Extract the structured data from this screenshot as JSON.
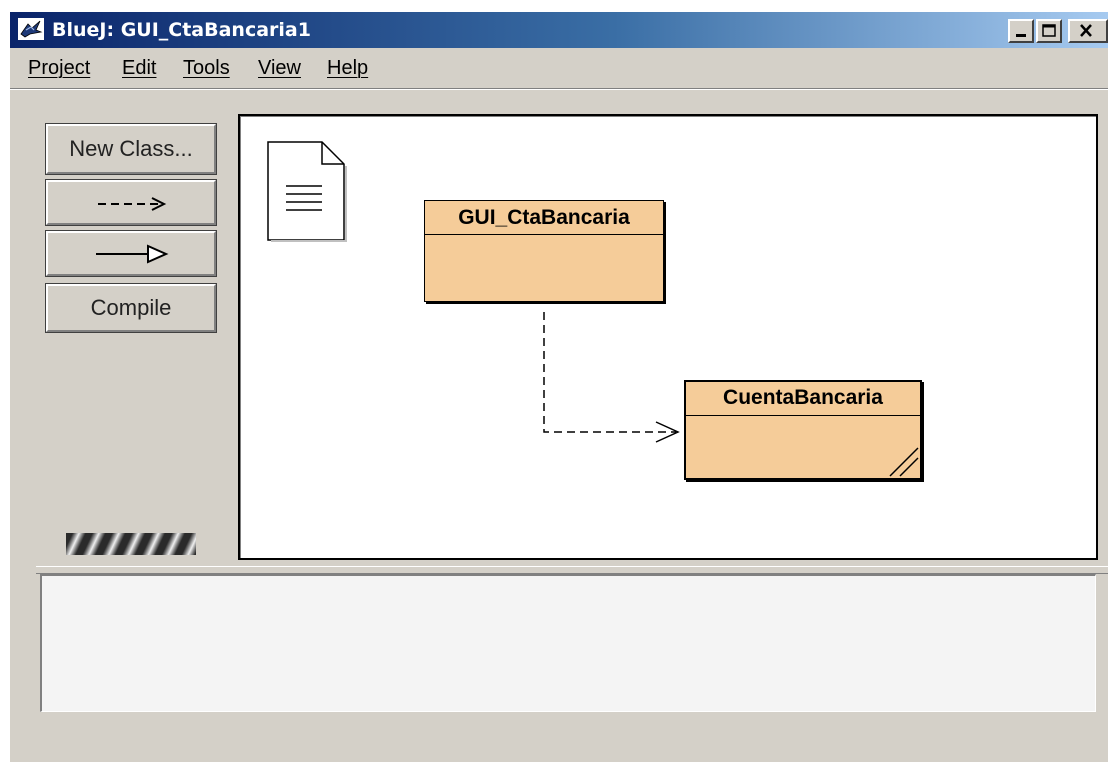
{
  "window": {
    "title": "BlueJ:  GUI_CtaBancaria1",
    "icon": "bluej-bird-icon"
  },
  "menu": {
    "items": [
      "Project",
      "Edit",
      "Tools",
      "View",
      "Help"
    ]
  },
  "toolbar": {
    "new_class_label": "New Class...",
    "dependency_icon": "dashed-arrow-icon",
    "inheritance_icon": "hollow-triangle-arrow-icon",
    "compile_label": "Compile"
  },
  "diagram": {
    "readme_icon": "readme-document-icon",
    "classes": [
      {
        "name": "GUI_CtaBancaria",
        "compiled": true
      },
      {
        "name": "CuentaBancaria",
        "compiled": false
      }
    ],
    "dependency": {
      "from": "GUI_CtaBancaria",
      "to": "CuentaBancaria",
      "style": "dashed"
    },
    "class_fill_color": "#f5cc99"
  },
  "messages": {
    "text": ""
  }
}
